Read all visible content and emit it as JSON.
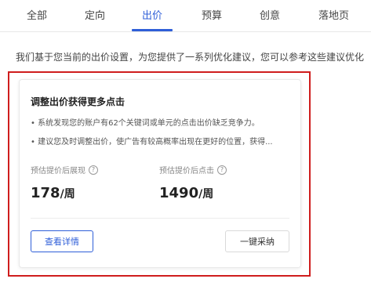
{
  "tabs": [
    "全部",
    "定向",
    "出价",
    "预算",
    "创意",
    "落地页"
  ],
  "active_tab": "出价",
  "intro_text": "我们基于您当前的出价设置，为您提供了一系列优化建议，您可以参考这些建议优化",
  "card": {
    "title": "调整出价获得更多点击",
    "bullets": [
      "• 系统发现您的账户有62个关键词或单元的点击出价缺乏竞争力。",
      "• 建议您及时调整出价，使广告有较高概率出现在更好的位置，获得..."
    ],
    "metrics": [
      {
        "label": "预估提价后展现",
        "value": "178",
        "unit": "/周"
      },
      {
        "label": "预估提价后点击",
        "value": "1490",
        "unit": "/周"
      }
    ],
    "info_icon": "info-circle-icon",
    "detail_button": "查看详情",
    "adopt_button": "一键采纳"
  },
  "colors": {
    "accent": "#2f5fd8",
    "highlight": "#cf1d1d"
  }
}
